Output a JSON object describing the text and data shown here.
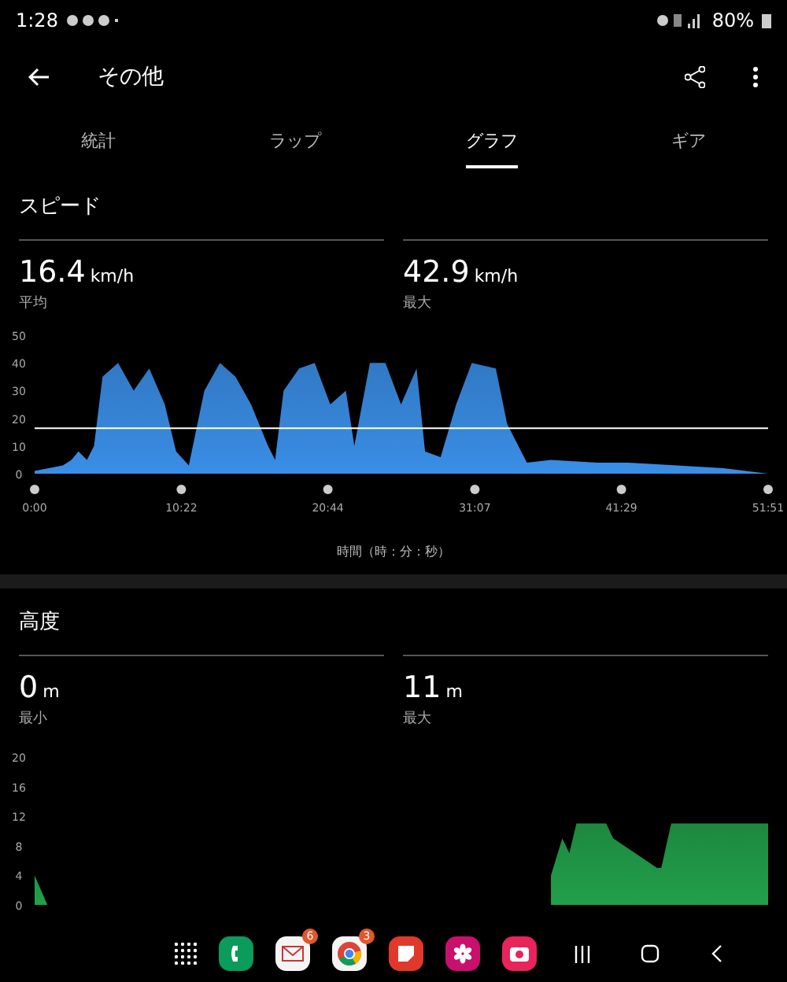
{
  "status_bar": {
    "time": "1:28",
    "battery": "80%"
  },
  "header": {
    "title": "その他"
  },
  "tabs": [
    {
      "label": "統計",
      "selected": false
    },
    {
      "label": "ラップ",
      "selected": false
    },
    {
      "label": "グラフ",
      "selected": true
    },
    {
      "label": "ギア",
      "selected": false
    }
  ],
  "sections": [
    {
      "title": "スピード",
      "stats": [
        {
          "value": "16.4",
          "unit": "km/h",
          "label": "平均"
        },
        {
          "value": "42.9",
          "unit": "km/h",
          "label": "最大"
        }
      ],
      "chart_data": {
        "type": "area",
        "xlabel": "時間（時：分：秒）",
        "ylim": [
          0,
          50
        ],
        "yticks": [
          0,
          10,
          20,
          30,
          40,
          50
        ],
        "xlim": [
          0,
          51.85
        ],
        "xticks": [
          {
            "value": 0,
            "label": "0:00"
          },
          {
            "value": 10.37,
            "label": "10:22"
          },
          {
            "value": 20.73,
            "label": "20:44"
          },
          {
            "value": 31.12,
            "label": "31:07"
          },
          {
            "value": 41.48,
            "label": "41:29"
          },
          {
            "value": 51.85,
            "label": "51:51"
          }
        ],
        "x": [
          0,
          2,
          2.6,
          3.1,
          3.7,
          4.2,
          4.8,
          5.9,
          7,
          8.1,
          9.2,
          10,
          10.9,
          12,
          13.1,
          14.2,
          15.3,
          16.5,
          17,
          17.6,
          18.7,
          19.8,
          20.9,
          22,
          22.6,
          23.7,
          24.8,
          25.9,
          27,
          27.6,
          28.7,
          29.8,
          30.9,
          32.6,
          33.4,
          34.8,
          36.5,
          39.8,
          42,
          45.4,
          48.7,
          51.85
        ],
        "series": [
          {
            "color": "#3a8ee6",
            "values": [
              1,
              3,
              5,
              8,
              5,
              10,
              35,
              40,
              30,
              38,
              25,
              8,
              3,
              30,
              40,
              35,
              25,
              10,
              5,
              30,
              38,
              40,
              25,
              30,
              10,
              40,
              40,
              25,
              38,
              8,
              6,
              25,
              40,
              38,
              18,
              4,
              5,
              4,
              4,
              3,
              2,
              0
            ]
          }
        ],
        "ref_lines": [
          {
            "axis": "y",
            "value": 16.4
          }
        ]
      }
    },
    {
      "title": "高度",
      "stats": [
        {
          "value": "0",
          "unit": "m",
          "label": "最小"
        },
        {
          "value": "11",
          "unit": "m",
          "label": "最大"
        }
      ],
      "chart_data": {
        "type": "area",
        "ylim": [
          0,
          20
        ],
        "yticks": [
          0,
          4,
          8,
          12,
          16,
          20
        ],
        "xlim": [
          0,
          51.85
        ],
        "x": [
          0,
          0.9,
          35.2,
          36.5,
          37.3,
          37.8,
          38.3,
          39,
          40.4,
          40.9,
          44,
          44.3,
          45,
          45.4,
          51.85
        ],
        "series": [
          {
            "color": "#22a04a",
            "values": [
              4,
              0,
              null,
              4,
              9,
              7,
              11,
              11,
              11,
              9,
              5,
              5,
              11,
              11,
              11
            ]
          }
        ]
      }
    }
  ],
  "dock": [
    {
      "kind": "grid"
    },
    {
      "kind": "phone"
    },
    {
      "kind": "mail",
      "badge": "6"
    },
    {
      "kind": "browser",
      "badge": "3"
    },
    {
      "kind": "notes"
    },
    {
      "kind": "flower"
    },
    {
      "kind": "camera"
    }
  ]
}
